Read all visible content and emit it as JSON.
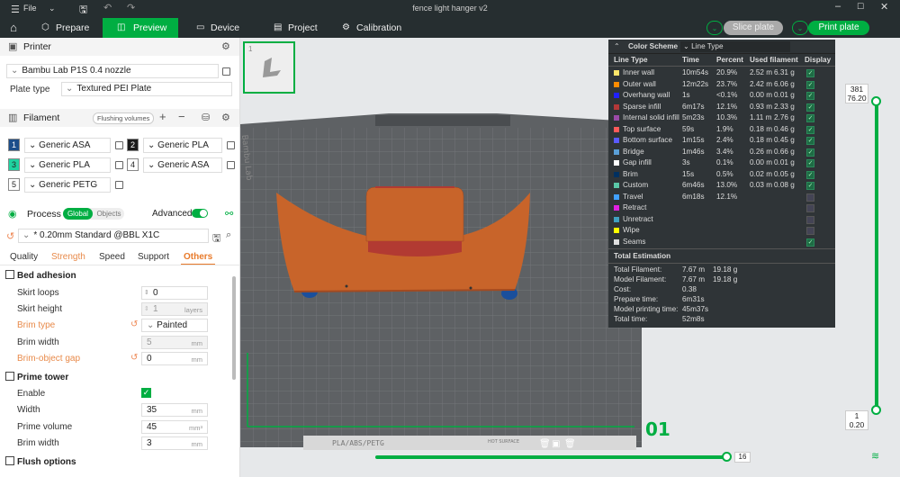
{
  "titlebar": {
    "file_label": "File",
    "title": "fence light hanger v2"
  },
  "tabs": [
    {
      "label": "Prepare"
    },
    {
      "label": "Preview"
    },
    {
      "label": "Device"
    },
    {
      "label": "Project"
    },
    {
      "label": "Calibration"
    }
  ],
  "actions": {
    "slice_label": "Slice plate",
    "print_label": "Print plate"
  },
  "printer": {
    "section_label": "Printer",
    "name": "Bambu Lab P1S 0.4 nozzle",
    "plate_type_label": "Plate type",
    "plate_type": "Textured PEI Plate"
  },
  "filament": {
    "section_label": "Filament",
    "flushing_label": "Flushing volumes",
    "items": [
      {
        "num": "1",
        "name": "Generic ASA",
        "color": "#1c4e8a"
      },
      {
        "num": "2",
        "name": "Generic PLA",
        "color": "#1a1a1a"
      },
      {
        "num": "3",
        "name": "Generic PLA",
        "color": "#1fd3a0"
      },
      {
        "num": "4",
        "name": "Generic ASA",
        "color": "#ffffff"
      },
      {
        "num": "5",
        "name": "Generic PETG",
        "color": "#ffffff"
      }
    ]
  },
  "process": {
    "section_label": "Process",
    "global_label": "Global",
    "objects_label": "Objects",
    "advanced_label": "Advanced",
    "preset": "* 0.20mm Standard @BBL X1C",
    "subtabs": [
      "Quality",
      "Strength",
      "Speed",
      "Support",
      "Others"
    ]
  },
  "bed_adhesion": {
    "title": "Bed adhesion",
    "skirt_loops_label": "Skirt loops",
    "skirt_loops": "0",
    "skirt_height_label": "Skirt height",
    "skirt_height": "1",
    "skirt_height_unit": "layers",
    "brim_type_label": "Brim type",
    "brim_type": "Painted",
    "brim_width_label": "Brim width",
    "brim_width": "5",
    "brim_width_unit": "mm",
    "brim_gap_label": "Brim-object gap",
    "brim_gap": "0",
    "brim_gap_unit": "mm"
  },
  "prime_tower": {
    "title": "Prime tower",
    "enable_label": "Enable",
    "width_label": "Width",
    "width": "35",
    "width_unit": "mm",
    "volume_label": "Prime volume",
    "volume": "45",
    "volume_unit": "mm³",
    "brim_label": "Brim width",
    "brim": "3",
    "brim_unit": "mm"
  },
  "flush_options": {
    "title": "Flush options"
  },
  "color_scheme": {
    "label": "Color Scheme",
    "mode": "Line Type",
    "headers": [
      "Line Type",
      "Time",
      "Percent",
      "Used filament",
      "Display"
    ],
    "rows": [
      {
        "name": "Inner wall",
        "time": "10m54s",
        "pct": "20.9%",
        "m": "2.52 m",
        "g": "6.31 g",
        "color": "#ffe66a",
        "shown": true
      },
      {
        "name": "Outer wall",
        "time": "12m22s",
        "pct": "23.7%",
        "m": "2.42 m",
        "g": "6.06 g",
        "color": "#ff8c00",
        "shown": true
      },
      {
        "name": "Overhang wall",
        "time": "1s",
        "pct": "<0.1%",
        "m": "0.00 m",
        "g": "0.01 g",
        "color": "#2020ff",
        "shown": true
      },
      {
        "name": "Sparse infill",
        "time": "6m17s",
        "pct": "12.1%",
        "m": "0.93 m",
        "g": "2.33 g",
        "color": "#b43838",
        "shown": true
      },
      {
        "name": "Internal solid infill",
        "time": "5m23s",
        "pct": "10.3%",
        "m": "1.11 m",
        "g": "2.76 g",
        "color": "#9a4aa8",
        "shown": true
      },
      {
        "name": "Top surface",
        "time": "59s",
        "pct": "1.9%",
        "m": "0.18 m",
        "g": "0.46 g",
        "color": "#ff5a5a",
        "shown": true
      },
      {
        "name": "Bottom surface",
        "time": "1m15s",
        "pct": "2.4%",
        "m": "0.18 m",
        "g": "0.45 g",
        "color": "#5a5aff",
        "shown": true
      },
      {
        "name": "Bridge",
        "time": "1m46s",
        "pct": "3.4%",
        "m": "0.26 m",
        "g": "0.66 g",
        "color": "#5aa0d8",
        "shown": true
      },
      {
        "name": "Gap infill",
        "time": "3s",
        "pct": "0.1%",
        "m": "0.00 m",
        "g": "0.01 g",
        "color": "#ffffff",
        "shown": true
      },
      {
        "name": "Brim",
        "time": "15s",
        "pct": "0.5%",
        "m": "0.02 m",
        "g": "0.05 g",
        "color": "#003060",
        "shown": true
      },
      {
        "name": "Custom",
        "time": "6m46s",
        "pct": "13.0%",
        "m": "0.03 m",
        "g": "0.08 g",
        "color": "#5ac8a8",
        "shown": true
      },
      {
        "name": "Travel",
        "time": "6m18s",
        "pct": "12.1%",
        "m": "",
        "g": "",
        "color": "#40a0ff",
        "shown": false
      },
      {
        "name": "Retract",
        "time": "",
        "pct": "",
        "m": "",
        "g": "",
        "color": "#e020e0",
        "shown": false
      },
      {
        "name": "Unretract",
        "time": "",
        "pct": "",
        "m": "",
        "g": "",
        "color": "#40a0c0",
        "shown": false
      },
      {
        "name": "Wipe",
        "time": "",
        "pct": "",
        "m": "",
        "g": "",
        "color": "#ffff00",
        "shown": false
      },
      {
        "name": "Seams",
        "time": "",
        "pct": "",
        "m": "",
        "g": "",
        "color": "#e0e0e0",
        "shown": true
      }
    ],
    "estimation_title": "Total Estimation",
    "estimation": [
      {
        "label": "Total Filament:",
        "v1": "7.67 m",
        "v2": "19.18 g"
      },
      {
        "label": "Model Filament:",
        "v1": "7.67 m",
        "v2": "19.18 g"
      },
      {
        "label": "Cost:",
        "v1": "0.38",
        "v2": ""
      },
      {
        "label": "Prepare time:",
        "v1": "6m31s",
        "v2": ""
      },
      {
        "label": "Model printing time:",
        "v1": "45m37s",
        "v2": ""
      },
      {
        "label": "Total time:",
        "v1": "52m8s",
        "v2": ""
      }
    ]
  },
  "viewport": {
    "plate_number": "01",
    "bed_label": "PLA/ABS/PETG",
    "surface_label": "HOT SURFACE",
    "brand": "Bambu Lab"
  },
  "layer_slider": {
    "top_layer": "381",
    "top_height": "76.20",
    "bottom_layer": "1",
    "bottom_height": "0.20",
    "position_value": "16"
  },
  "thumbnail": {
    "index": "1"
  }
}
